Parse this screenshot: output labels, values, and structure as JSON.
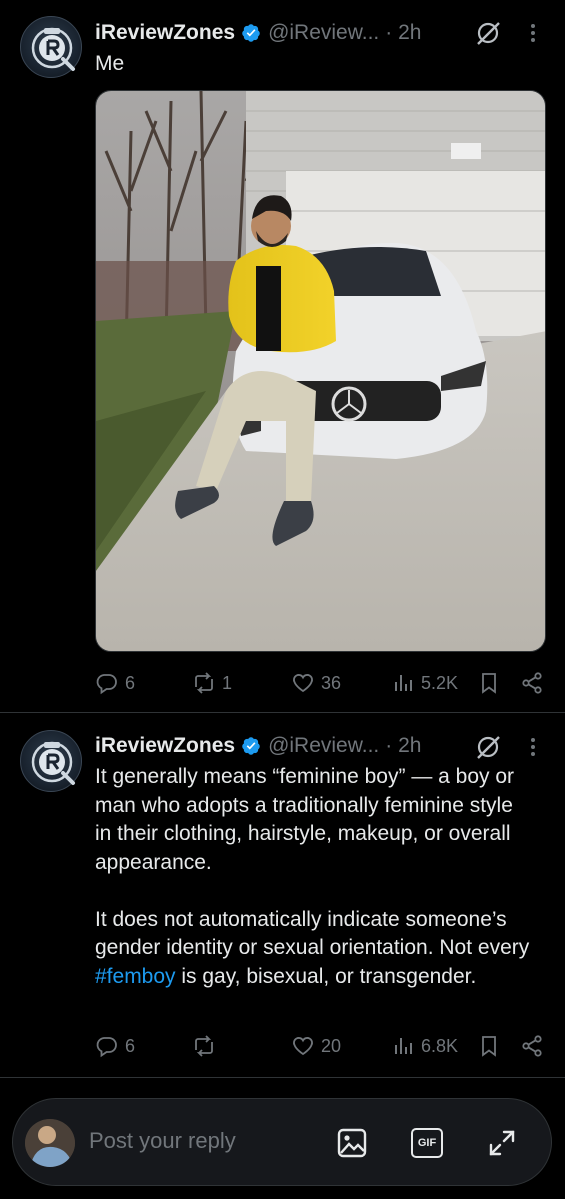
{
  "tweet1": {
    "name": "iReviewZones",
    "handle": "@iReview...",
    "time": "· 2h",
    "text": "Me",
    "replies": "6",
    "retweets": "1",
    "likes": "36",
    "views": "5.2K"
  },
  "tweet2": {
    "name": "iReviewZones",
    "handle": "@iReview...",
    "time": "· 2h",
    "para1": "It generally means “feminine boy” — a boy or man who adopts a traditionally feminine style in their clothing, hairstyle, makeup, or overall appearance.",
    "para2_before": "It does not automatically indicate someone’s gender identity or sexual orientation. Not every ",
    "para2_hashtag": "#femboy",
    "para2_after": " is gay, bisexual, or transgender.",
    "replies": "6",
    "likes": "20",
    "views": "6.8K"
  },
  "reply_bar": {
    "placeholder": "Post your reply",
    "gif_label": "GIF"
  },
  "colors": {
    "background": "#000000",
    "text": "#e7e9ea",
    "secondary": "#71767b",
    "accent": "#1d9bf0",
    "divider": "#2f3336"
  }
}
